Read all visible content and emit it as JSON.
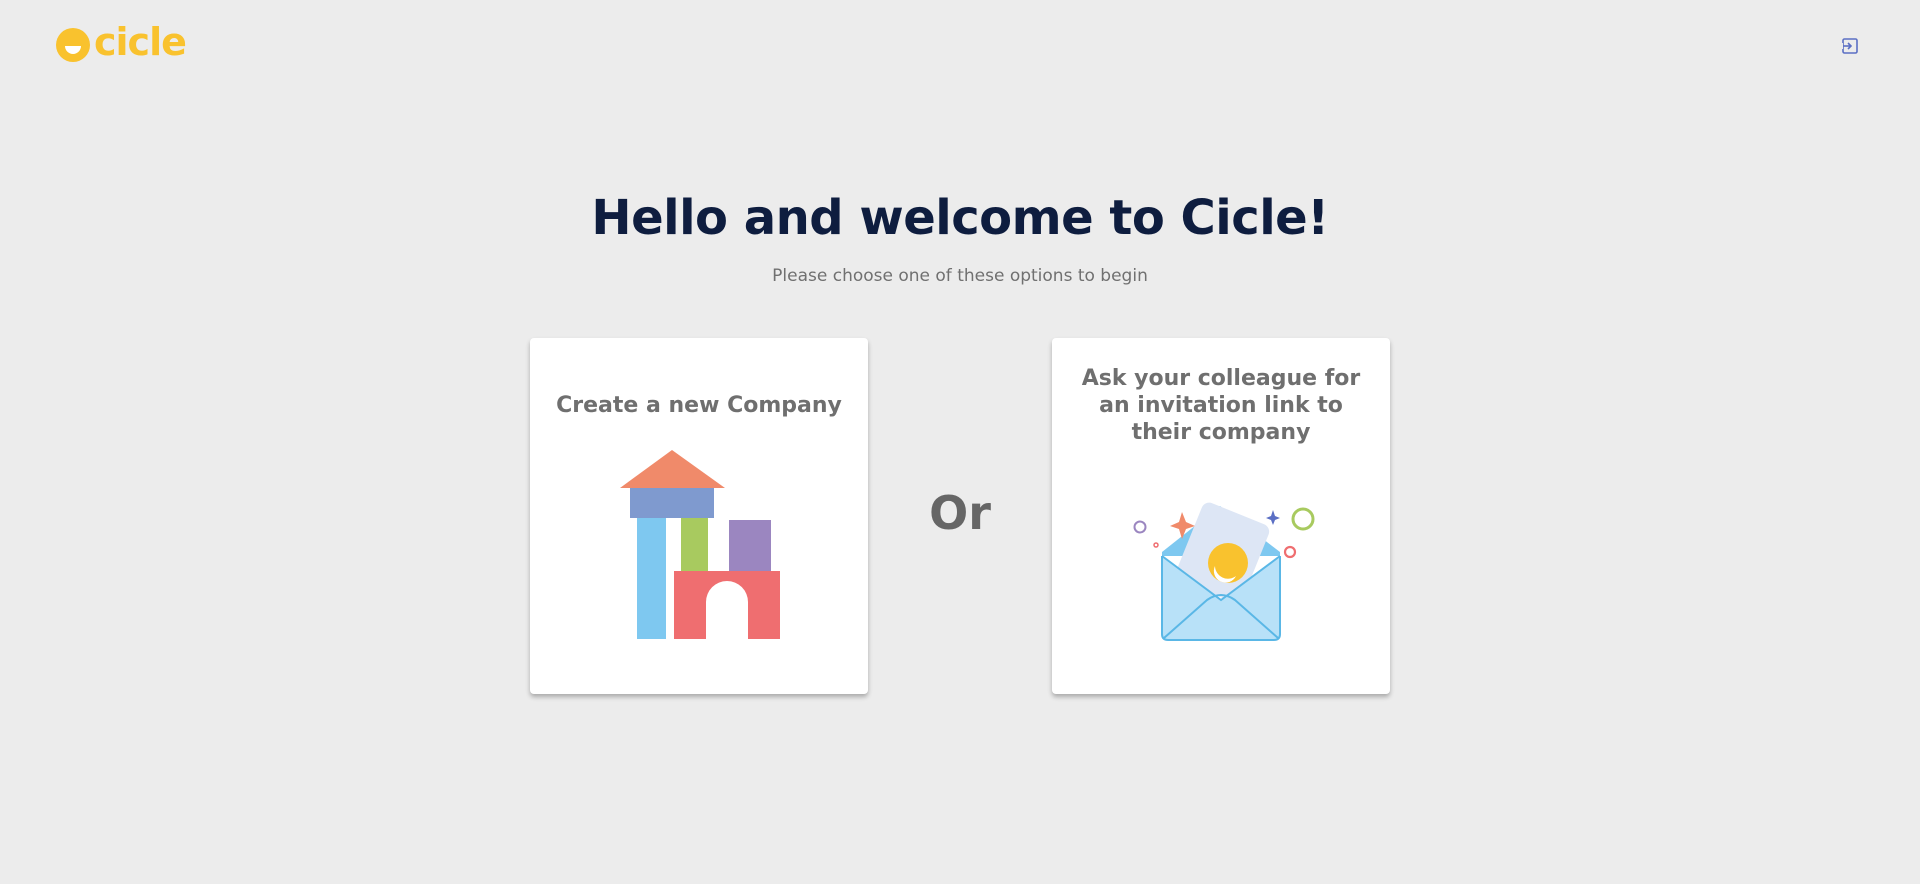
{
  "header": {
    "logo_text": "cicle",
    "logout_icon": "logout-icon"
  },
  "main": {
    "title": "Hello and welcome to Cicle!",
    "subtitle": "Please choose one of these options to begin",
    "separator": "Or",
    "options": [
      {
        "label": "Create a new Company",
        "icon": "building-blocks-illustration"
      },
      {
        "label": "Ask your colleague for an invitation link to their company",
        "icon": "envelope-invitation-illustration"
      }
    ]
  },
  "colors": {
    "brand_yellow": "#f9c22e",
    "title_navy": "#0e1d3f",
    "background": "#ececec"
  }
}
